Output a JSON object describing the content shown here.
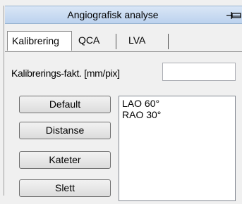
{
  "panel": {
    "title": "Angiografisk analyse",
    "pin_icon": "pin-icon"
  },
  "tabs": [
    {
      "label": "Kalibrering",
      "active": true
    },
    {
      "label": "QCA",
      "active": false
    },
    {
      "label": "LVA",
      "active": false
    }
  ],
  "calibration": {
    "label": "Kalibrerings-fakt. [mm/pix]",
    "value": ""
  },
  "buttons": {
    "default": "Default",
    "distance": "Distanse",
    "catheter": "Kateter",
    "delete": "Slett"
  },
  "projections": [
    "LAO 60°",
    "RAO 30°"
  ]
}
